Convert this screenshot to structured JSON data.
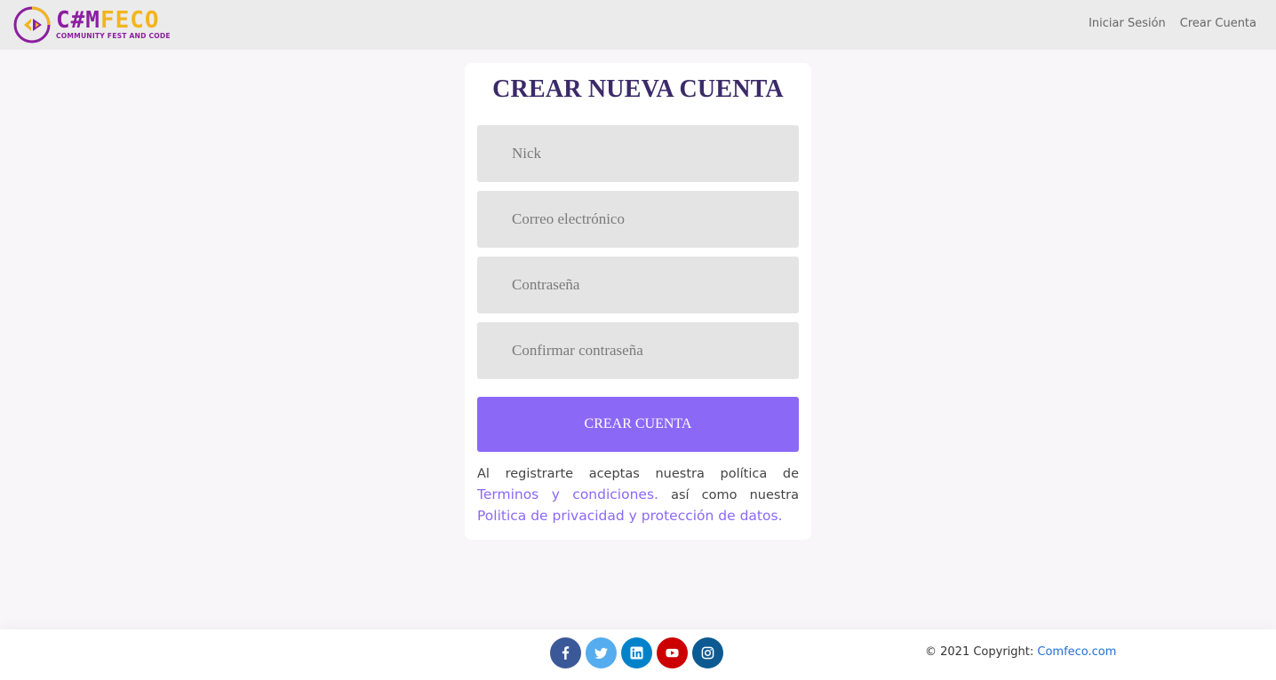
{
  "header": {
    "logo": {
      "text_a": "C#M",
      "text_b": "FECO",
      "subtitle": "COMMUNITY FEST AND CODE",
      "colors": {
        "purple": "#8b1fa0",
        "yellow": "#f2b51d"
      }
    },
    "nav": {
      "login": "Iniciar Sesión",
      "register": "Crear Cuenta"
    }
  },
  "form": {
    "title": "CREAR NUEVA CUENTA",
    "fields": {
      "nick": {
        "placeholder": "Nick",
        "value": ""
      },
      "email": {
        "placeholder": "Correo electrónico",
        "value": ""
      },
      "password": {
        "placeholder": "Contraseña",
        "value": ""
      },
      "confirm_password": {
        "placeholder": "Confirmar contraseña",
        "value": ""
      }
    },
    "submit_label": "CREAR CUENTA",
    "legal": {
      "text_1": "Al registrarte aceptas nuestra política de",
      "terms_link": "Terminos y condiciones.",
      "text_2": "así como nuestra",
      "privacy_link": "Politica de privacidad y protección de datos."
    },
    "accent_color": "#8c68f7"
  },
  "footer": {
    "socials": [
      {
        "name": "facebook",
        "icon": "facebook-icon",
        "color": "#3b5998"
      },
      {
        "name": "twitter",
        "icon": "twitter-icon",
        "color": "#55acee"
      },
      {
        "name": "linkedin",
        "icon": "linkedin-icon",
        "color": "#0082ca"
      },
      {
        "name": "youtube",
        "icon": "youtube-icon",
        "color": "#ed302f"
      },
      {
        "name": "instagram",
        "icon": "instagram-icon",
        "color": "#0d5a92"
      }
    ],
    "copyright_text": "© 2021 Copyright:",
    "copyright_link": "Comfeco.com"
  }
}
